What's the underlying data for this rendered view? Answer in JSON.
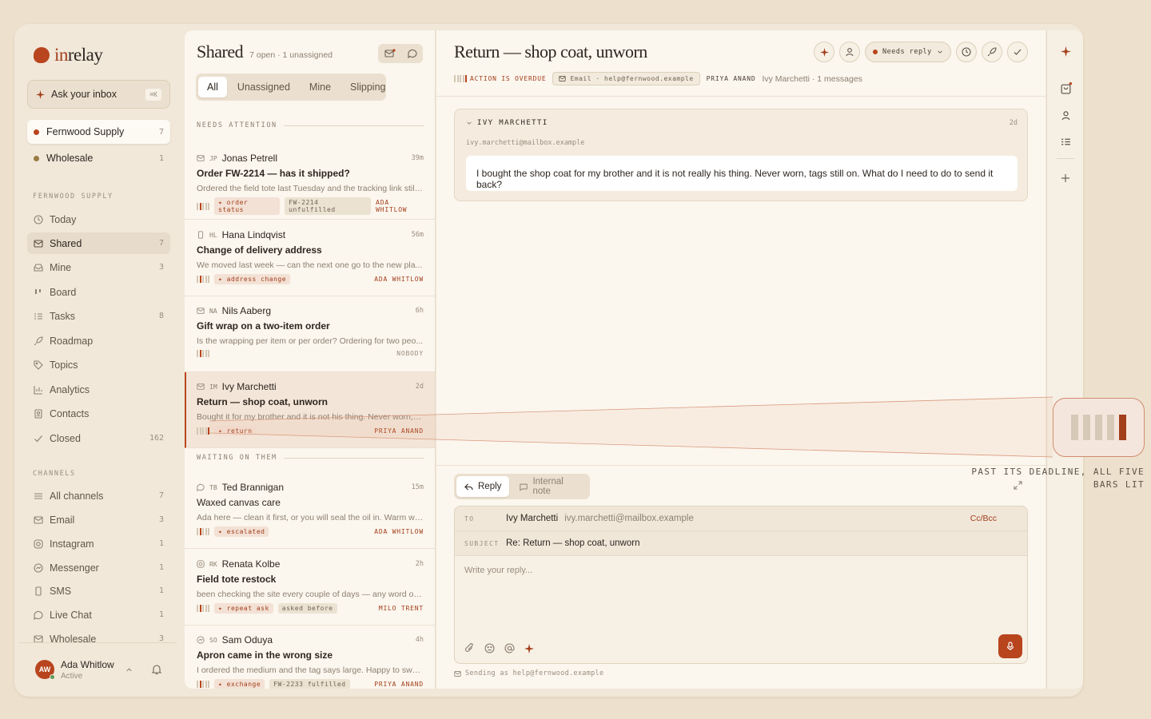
{
  "app": {
    "brand_prefix": "in",
    "brand_suffix": "relay",
    "ask_label": "Ask your inbox",
    "ask_shortcut": "⌘K"
  },
  "workspaces": [
    {
      "name": "Fernwood Supply",
      "count": "7",
      "color": "#b8451e"
    },
    {
      "name": "Wholesale",
      "count": "1",
      "color": "#9a7a40"
    }
  ],
  "sidebar": {
    "section_label": "FERNWOOD SUPPLY",
    "items": [
      {
        "label": "Today",
        "count": "",
        "icon": "clock-icon"
      },
      {
        "label": "Shared",
        "count": "7",
        "icon": "inbox-icon"
      },
      {
        "label": "Mine",
        "count": "3",
        "icon": "tray-icon"
      },
      {
        "label": "Board",
        "count": "",
        "icon": "board-icon"
      },
      {
        "label": "Tasks",
        "count": "8",
        "icon": "tasks-icon"
      },
      {
        "label": "Roadmap",
        "count": "",
        "icon": "rocket-icon"
      },
      {
        "label": "Topics",
        "count": "",
        "icon": "tag-icon"
      },
      {
        "label": "Analytics",
        "count": "",
        "icon": "chart-icon"
      },
      {
        "label": "Contacts",
        "count": "",
        "icon": "contact-icon"
      },
      {
        "label": "Closed",
        "count": "162",
        "icon": "check-icon"
      }
    ],
    "channels_label": "CHANNELS",
    "channels": [
      {
        "label": "All channels",
        "count": "7"
      },
      {
        "label": "Email",
        "count": "3"
      },
      {
        "label": "Instagram",
        "count": "1"
      },
      {
        "label": "Messenger",
        "count": "1"
      },
      {
        "label": "SMS",
        "count": "1"
      },
      {
        "label": "Live Chat",
        "count": "1"
      },
      {
        "label": "Wholesale",
        "count": "3"
      }
    ],
    "user": {
      "initials": "AW",
      "name": "Ada Whitlow",
      "status": "Active"
    }
  },
  "list": {
    "title": "Shared",
    "subtitle": "7 open · 1 unassigned",
    "tabs": [
      "All",
      "Unassigned",
      "Mine",
      "Slipping"
    ],
    "group1": "NEEDS ATTENTION",
    "group2": "WAITING ON THEM",
    "conversations": [
      {
        "initials": "JP",
        "name": "Jonas Petrell",
        "time": "39m",
        "subject": "Order FW-2214 — has it shipped?",
        "preview": "Ordered the field tote last Tuesday and the tracking link still ...",
        "urgency": 1,
        "tags": [
          {
            "t": "✦ order status",
            "k": "r"
          },
          {
            "t": "FW-2214 unfulfilled",
            "k": "g"
          }
        ],
        "owner": "ADA WHITLOW"
      },
      {
        "initials": "HL",
        "name": "Hana Lindqvist",
        "time": "56m",
        "subject": "Change of delivery address",
        "preview": "We moved last week — can the next one go to the new pla...",
        "urgency": 1,
        "tags": [
          {
            "t": "✦ address change",
            "k": "r"
          }
        ],
        "owner": "ADA WHITLOW"
      },
      {
        "initials": "NA",
        "name": "Nils Aaberg",
        "time": "6h",
        "subject": "Gift wrap on a two-item order",
        "preview": "Is the wrapping per item or per order? Ordering for two peo...",
        "urgency": 1,
        "tags": [],
        "owner": "NOBODY"
      },
      {
        "initials": "IM",
        "name": "Ivy Marchetti",
        "time": "2d",
        "subject": "Return — shop coat, unworn",
        "preview": "Bought it for my brother and it is not his thing. Never worn, t...",
        "urgency": 5,
        "tags": [
          {
            "t": "✦ return",
            "k": "r"
          }
        ],
        "owner": "PRIYA ANAND"
      },
      {
        "initials": "TB",
        "name": "Ted Brannigan",
        "time": "15m",
        "subject": "Waxed canvas care",
        "preview": "Ada here — clean it first, or you will seal the oil in. Warm wat...",
        "urgency": 1,
        "tags": [
          {
            "t": "✦ escalated",
            "k": "r"
          }
        ],
        "owner": "ADA WHITLOW"
      },
      {
        "initials": "RK",
        "name": "Renata Kolbe",
        "time": "2h",
        "subject": "Field tote restock",
        "preview": "been checking the site every couple of days — any word on...",
        "urgency": 1,
        "tags": [
          {
            "t": "✦ repeat ask",
            "k": "r"
          },
          {
            "t": "asked before",
            "k": "g"
          }
        ],
        "owner": "MILO TRENT"
      },
      {
        "initials": "SO",
        "name": "Sam Oduya",
        "time": "4h",
        "subject": "Apron came in the wrong size",
        "preview": "I ordered the medium and the tag says large. Happy to swa...",
        "urgency": 1,
        "tags": [
          {
            "t": "✦ exchange",
            "k": "r"
          },
          {
            "t": "FW-2233 fulfilled",
            "k": "g"
          }
        ],
        "owner": "PRIYA ANAND"
      }
    ]
  },
  "thread": {
    "title": "Return — shop coat, unworn",
    "overdue": "ACTION IS OVERDUE",
    "channel": "Email · help@fernwood.example",
    "assignee": "PRIYA ANAND",
    "meta": "Ivy Marchetti · 1 messages",
    "status": "Needs reply",
    "message": {
      "from": "IVY MARCHETTI",
      "age": "2d",
      "email": "ivy.marchetti@mailbox.example",
      "body": "I bought the shop coat for my brother and it is not really his thing. Never worn, tags still on. What do I need to do to send it back?"
    },
    "reply_tab": "Reply",
    "note_tab": "Internal note",
    "to_label": "TO",
    "to_name": "Ivy Marchetti",
    "to_email": "ivy.marchetti@mailbox.example",
    "cc": "Cc/Bcc",
    "subject_label": "SUBJECT",
    "subject": "Re: Return — shop coat, unworn",
    "placeholder": "Write your reply...",
    "sending": "Sending as help@fernwood.example"
  },
  "callout": {
    "caption": "PAST ITS DEADLINE, ALL FIVE BARS LIT",
    "lit_bars": 5
  },
  "colors": {
    "accent": "#b8451e",
    "background": "#ede1cd",
    "panel": "#fbf6ee"
  }
}
